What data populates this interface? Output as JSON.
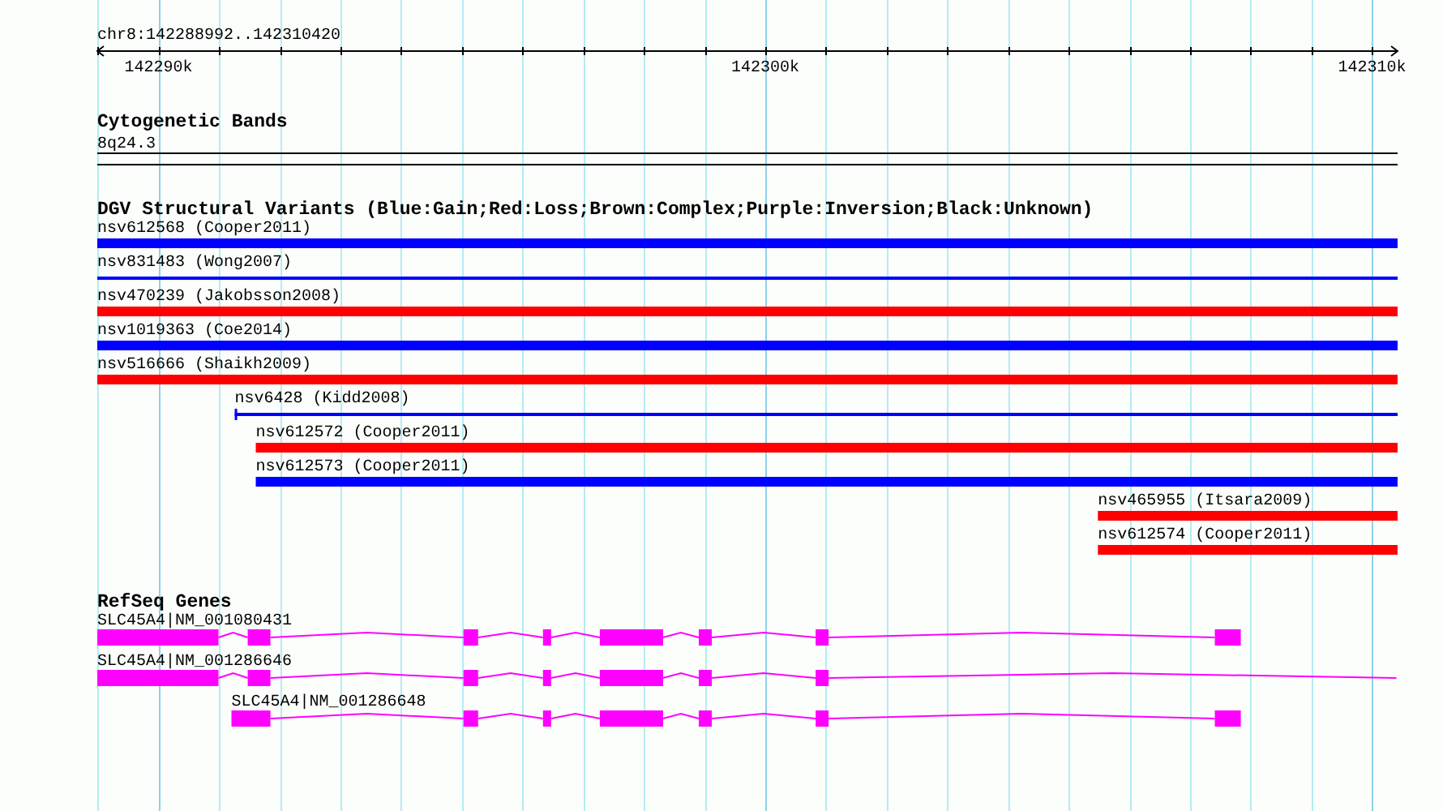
{
  "ruler": {
    "region": "chr8:142288992..142310420",
    "ticks": [
      {
        "label": "142290k"
      },
      {
        "label": "142300k"
      },
      {
        "label": "142310k"
      }
    ]
  },
  "tracks": [
    {
      "kind": "bands",
      "title": "Cytogenetic Bands",
      "features": [
        {
          "label": "8q24.3"
        }
      ]
    },
    {
      "kind": "variants",
      "title": "DGV Structural Variants (Blue:Gain;Red:Loss;Brown:Complex;Purple:Inversion;Black:Unknown)",
      "features": [
        {
          "label": "nsv612568 (Cooper2011)",
          "kind": "bar",
          "color": "#0000ff"
        },
        {
          "label": "nsv831483 (Wong2007)",
          "kind": "line",
          "color": "#0000ff"
        },
        {
          "label": "nsv470239 (Jakobsson2008)",
          "kind": "bar",
          "color": "#ff0000"
        },
        {
          "label": "nsv1019363 (Coe2014)",
          "kind": "bar",
          "color": "#0000ff"
        },
        {
          "label": "nsv516666 (Shaikh2009)",
          "kind": "bar",
          "color": "#ff0000"
        },
        {
          "label": "nsv6428 (Kidd2008)",
          "kind": "line",
          "color": "#0000ff"
        },
        {
          "label": "nsv612572 (Cooper2011)",
          "kind": "bar",
          "color": "#ff0000"
        },
        {
          "label": "nsv612573 (Cooper2011)",
          "kind": "bar",
          "color": "#0000ff"
        },
        {
          "label": "nsv465955 (Itsara2009)",
          "kind": "bar",
          "color": "#ff0000"
        },
        {
          "label": "nsv612574 (Cooper2011)",
          "kind": "bar",
          "color": "#ff0000"
        }
      ]
    },
    {
      "kind": "genes",
      "title": "RefSeq Genes",
      "features": [
        {
          "label": "SLC45A4|NM_001080431"
        },
        {
          "label": "SLC45A4|NM_001286646"
        },
        {
          "label": "SLC45A4|NM_001286648"
        }
      ]
    }
  ]
}
